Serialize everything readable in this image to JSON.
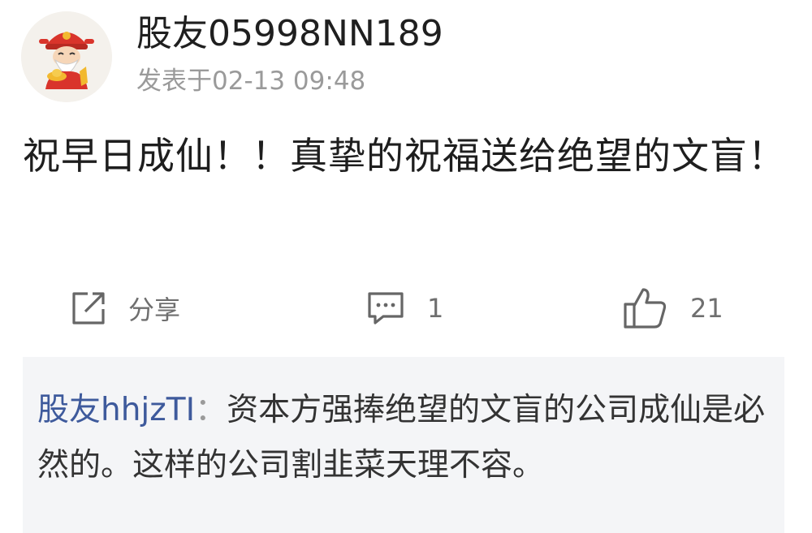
{
  "post": {
    "author": "股友05998NN189",
    "timestamp": "发表于02-13 09:48",
    "body": "祝早日成仙！！真挚的祝福送给绝望的文盲！"
  },
  "actions": {
    "share_label": "分享",
    "comment_count": "1",
    "like_count": "21"
  },
  "reply": {
    "author": "股友hhjzTI",
    "separator": "：",
    "text": "资本方强捧绝望的文盲的公司成仙是必然的。这样的公司割韭菜天理不容。"
  },
  "icons": {
    "avatar": "god-of-wealth-avatar",
    "share": "share-icon",
    "comment": "comment-icon",
    "like": "thumbs-up-icon"
  },
  "colors": {
    "reply_author": "#3e5a9c",
    "muted_text": "#9a9a9a",
    "reply_background": "#f4f5f7"
  }
}
